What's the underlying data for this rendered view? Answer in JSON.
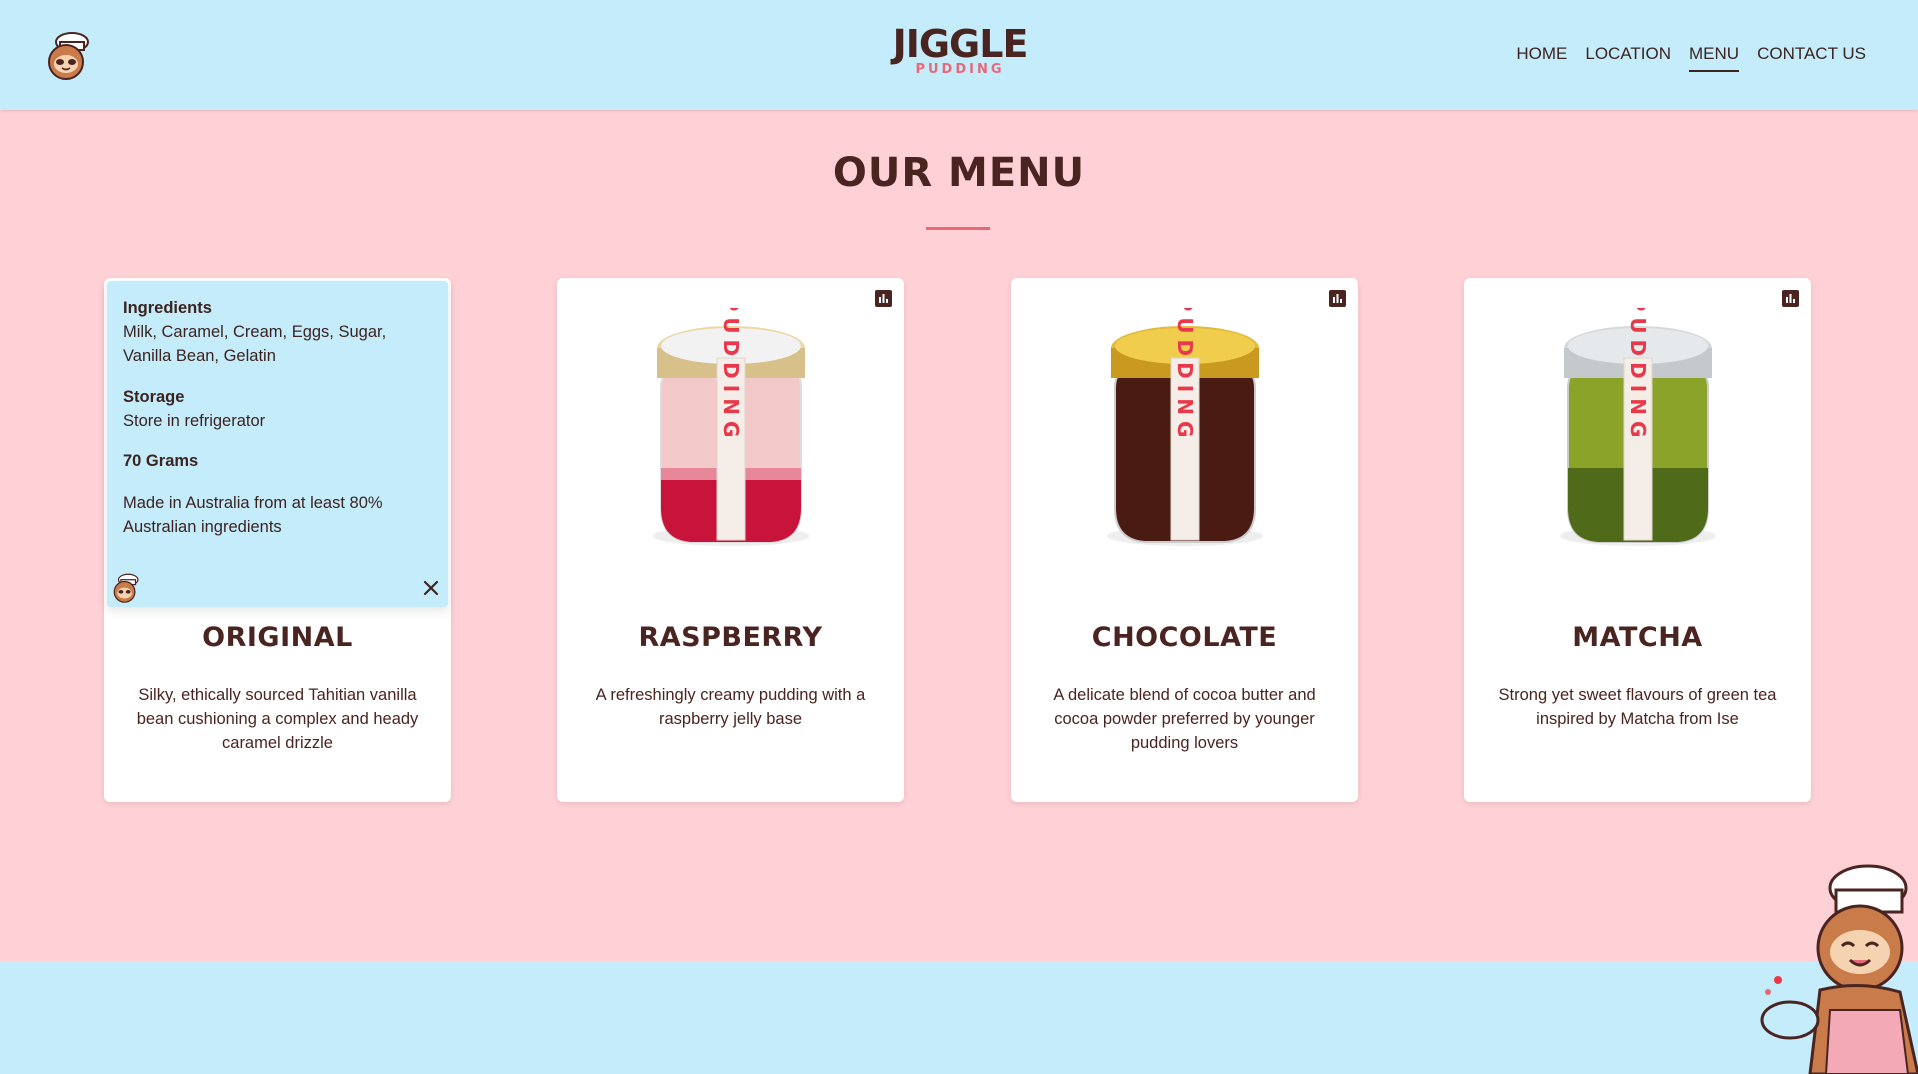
{
  "header": {
    "brand_main": "JIGGLE",
    "brand_sub": "PUDDING",
    "nav": [
      {
        "label": "HOME",
        "active": false
      },
      {
        "label": "LOCATION",
        "active": false
      },
      {
        "label": "MENU",
        "active": true
      },
      {
        "label": "CONTACT US",
        "active": false
      }
    ]
  },
  "menu": {
    "title": "OUR MENU",
    "items": [
      {
        "name": "ORIGINAL",
        "description": "Silky, ethically sourced Tahitian vanilla bean cushioning a complex and heady caramel drizzle",
        "details": {
          "ingredients_label": "Ingredients",
          "ingredients": "Milk, Caramel, Cream, Eggs, Sugar, Vanilla Bean, Gelatin",
          "storage_label": "Storage",
          "storage": "Store in refrigerator",
          "weight": "70 Grams",
          "origin": "Made in Australia from at least 80% Australian ingredients"
        }
      },
      {
        "name": "RASPBERRY",
        "description": "A refreshingly creamy pudding with a raspberry jelly base"
      },
      {
        "name": "CHOCOLATE",
        "description": "A delicate blend of cocoa butter and cocoa powder preferred by younger pudding lovers"
      },
      {
        "name": "MATCHA",
        "description": "Strong yet sweet flavours of green tea inspired by Matcha from Ise"
      }
    ]
  },
  "jar_label_text": "PUDDING",
  "colors": {
    "header_bg": "#c4ecfb",
    "page_bg": "#ffd1d6",
    "text_dark": "#4a2420",
    "accent_pink": "#e8687a"
  },
  "icons": [
    "sloth-chef-logo-icon",
    "bar-chart-icon",
    "close-icon",
    "sloth-chef-mascot-icon"
  ]
}
